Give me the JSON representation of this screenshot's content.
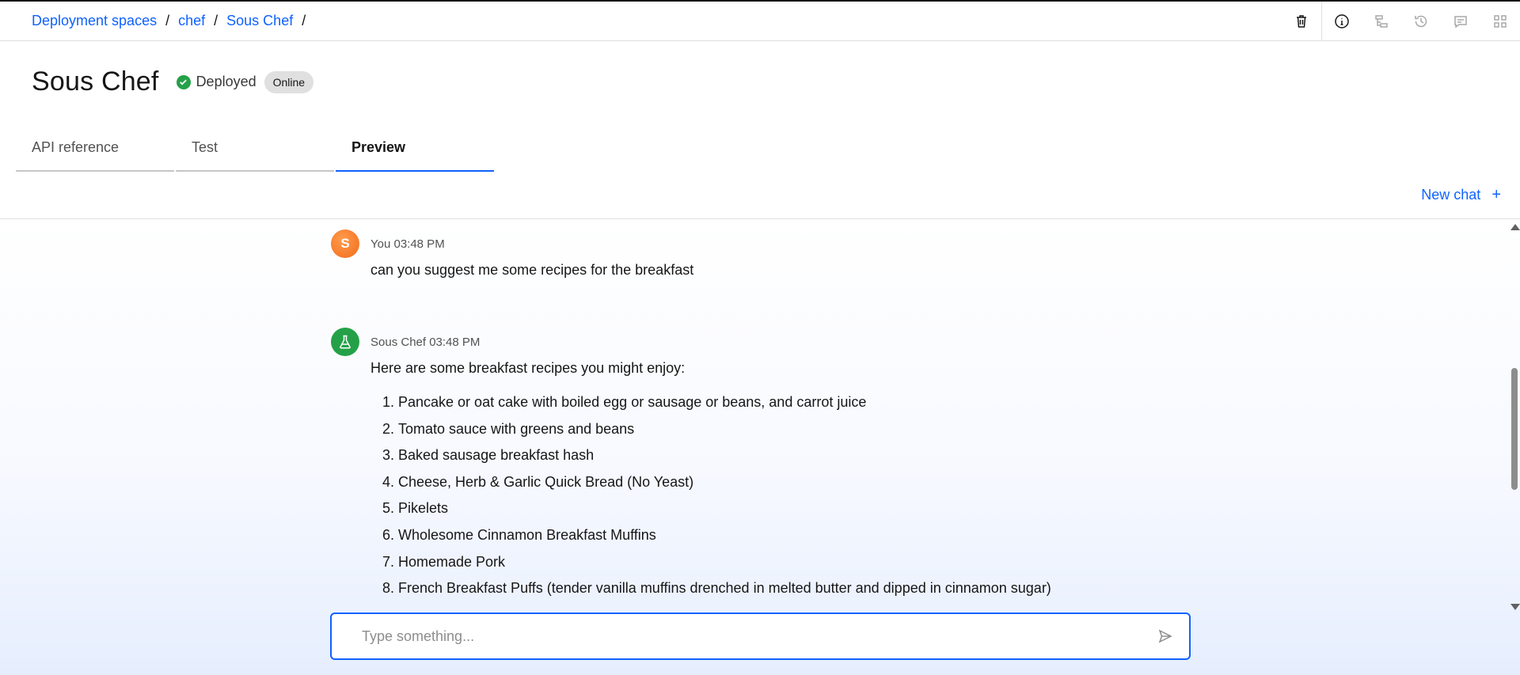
{
  "breadcrumb": {
    "items": [
      "Deployment spaces",
      "chef",
      "Sous Chef"
    ],
    "separator": "/"
  },
  "toolbar": {
    "icons": [
      "trash-icon",
      "info-icon",
      "tree-icon",
      "history-icon",
      "comment-icon",
      "grid-icon"
    ]
  },
  "page": {
    "title": "Sous Chef",
    "status_label": "Deployed",
    "badge": "Online"
  },
  "tabs": [
    {
      "label": "API reference",
      "active": false
    },
    {
      "label": "Test",
      "active": false
    },
    {
      "label": "Preview",
      "active": true
    }
  ],
  "new_chat": {
    "label": "New chat",
    "icon": "+"
  },
  "messages": [
    {
      "author": "You",
      "avatar_letter": "S",
      "meta": "You 03:48 PM",
      "text": "can you suggest me some recipes for the breakfast"
    },
    {
      "author": "Sous Chef",
      "avatar_icon": "flask-icon",
      "meta": "Sous Chef 03:48 PM",
      "text": "Here are some breakfast recipes you might enjoy:",
      "list": [
        "Pancake or oat cake with boiled egg or sausage or beans, and carrot juice",
        "Tomato sauce with greens and beans",
        "Baked sausage breakfast hash",
        "Cheese, Herb & Garlic Quick Bread (No Yeast)",
        "Pikelets",
        "Wholesome Cinnamon Breakfast Muffins",
        "Homemade Pork",
        "French Breakfast Puffs (tender vanilla muffins drenched in melted butter and dipped in cinnamon sugar)"
      ]
    }
  ],
  "composer": {
    "placeholder": "Type something...",
    "value": ""
  },
  "colors": {
    "accent": "#0f62fe",
    "success": "#24a148",
    "user_avatar": "#f26b1d"
  }
}
